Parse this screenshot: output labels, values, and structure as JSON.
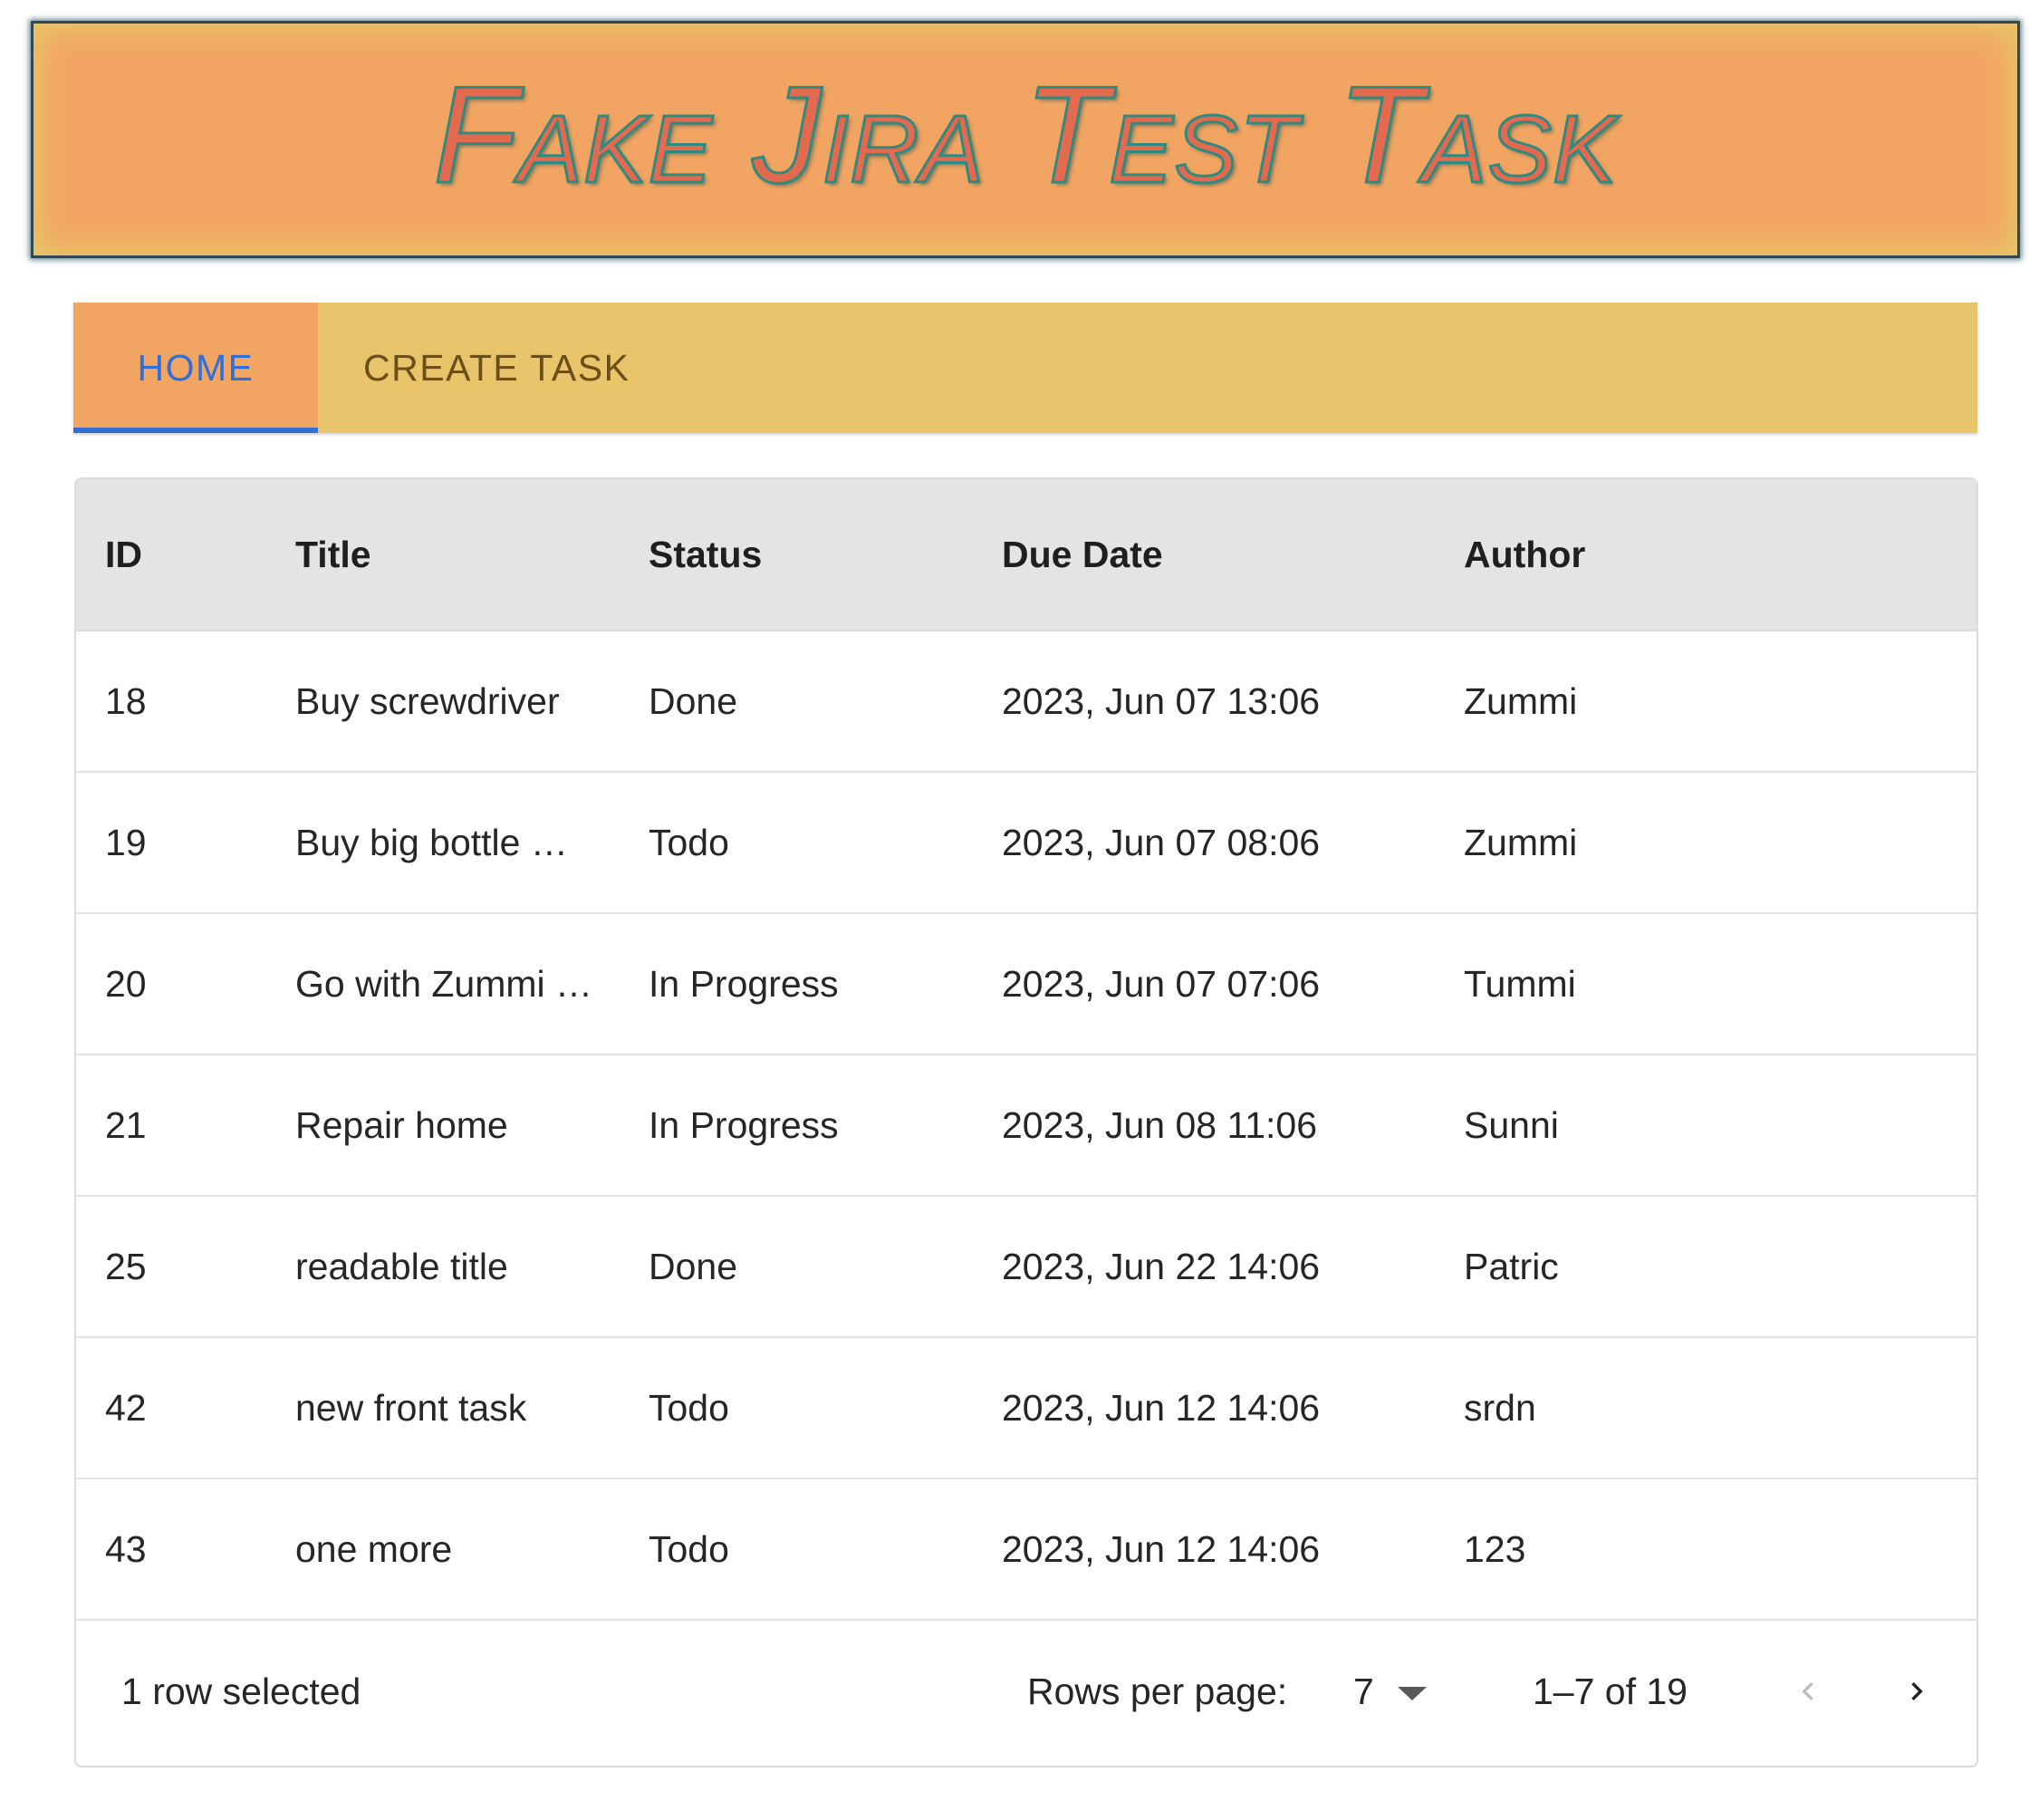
{
  "banner": {
    "title": "Fake Jira Test Task"
  },
  "nav": {
    "tabs": [
      {
        "label": "HOME",
        "active": true
      },
      {
        "label": "CREATE TASK",
        "active": false
      }
    ]
  },
  "table": {
    "columns": {
      "id": "ID",
      "title": "Title",
      "status": "Status",
      "due": "Due Date",
      "author": "Author"
    },
    "rows": [
      {
        "id": "18",
        "title": "Buy screwdriver",
        "status": "Done",
        "due": "2023, Jun 07 13:06",
        "author": "Zummi"
      },
      {
        "id": "19",
        "title": "Buy big bottle …",
        "status": "Todo",
        "due": "2023, Jun 07 08:06",
        "author": "Zummi"
      },
      {
        "id": "20",
        "title": "Go with Zummi …",
        "status": "In Progress",
        "due": "2023, Jun 07 07:06",
        "author": "Tummi"
      },
      {
        "id": "21",
        "title": "Repair home",
        "status": "In Progress",
        "due": "2023, Jun 08 11:06",
        "author": "Sunni"
      },
      {
        "id": "25",
        "title": "readable title",
        "status": "Done",
        "due": "2023, Jun 22 14:06",
        "author": "Patric"
      },
      {
        "id": "42",
        "title": "new front task",
        "status": "Todo",
        "due": "2023, Jun 12 14:06",
        "author": "srdn"
      },
      {
        "id": "43",
        "title": "one more",
        "status": "Todo",
        "due": "2023, Jun 12 14:06",
        "author": "123"
      }
    ]
  },
  "footer": {
    "selected_text": "1 row selected",
    "rows_per_page_label": "Rows per page:",
    "rows_per_page_value": "7",
    "range_text": "1–7 of 19",
    "icons": {
      "prev": "chevron-left-icon",
      "next": "chevron-right-icon",
      "dropdown": "caret-down-icon"
    }
  },
  "colors": {
    "banner_bg": "#f2a562",
    "banner_glow": "#e8c46a",
    "navbar_bg": "#e8c46a",
    "active_tab_bg": "#f2a562",
    "active_tab_accent": "#2f6fd6",
    "inactive_tab_text": "#6b4f18",
    "header_row_bg": "#e4e4e4"
  }
}
